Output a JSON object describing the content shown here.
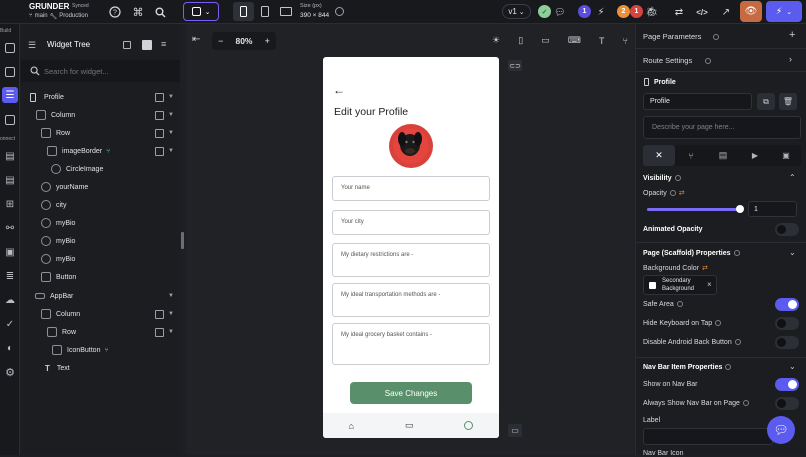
{
  "app": {
    "name": "GRUNDER",
    "sync_status": "Synced",
    "branch": "main",
    "environment": "Production"
  },
  "device": {
    "size_label": "Size (px)",
    "size_value": "390 × 844"
  },
  "version": {
    "label": "v1"
  },
  "badges": {
    "purple_count": "1",
    "orange_count": "2",
    "red_count": "1"
  },
  "colors": {
    "accent": "#5b5bf0",
    "brand_green": "#5a8f6b",
    "panel_bg": "#1b1d21",
    "warn_orange": "#e8913a",
    "error_red": "#d6453d"
  },
  "rail": {
    "build_label": "Build",
    "connect_label": "onnect"
  },
  "widget_tree": {
    "title": "Widget Tree",
    "search_placeholder": "Search for widget...",
    "items": [
      {
        "label": "Profile"
      },
      {
        "label": "Column"
      },
      {
        "label": "Row"
      },
      {
        "label": "imageBorder"
      },
      {
        "label": "CircleImage"
      },
      {
        "label": "yourName"
      },
      {
        "label": "city"
      },
      {
        "label": "myBio"
      },
      {
        "label": "myBio"
      },
      {
        "label": "myBio"
      },
      {
        "label": "Button"
      },
      {
        "label": "AppBar"
      },
      {
        "label": "Column"
      },
      {
        "label": "Row"
      },
      {
        "label": "IconButton"
      },
      {
        "label": "Text"
      }
    ]
  },
  "canvas": {
    "zoom": "80%"
  },
  "phone": {
    "title": "Edit your Profile",
    "fields": [
      {
        "placeholder": "Your name"
      },
      {
        "placeholder": "Your city"
      },
      {
        "placeholder": "My dietary restrictions are -"
      },
      {
        "placeholder": "My ideal transportation methods are -"
      },
      {
        "placeholder": "My ideal grocery basket contains -"
      }
    ],
    "save_button": "Save Changes"
  },
  "right_panel": {
    "page_parameters": "Page Parameters",
    "route_settings": "Route Settings",
    "page_label": "Profile",
    "page_name_value": "Profile",
    "description_placeholder": "Describe your page here...",
    "visibility": "Visibility",
    "opacity_label": "Opacity",
    "opacity_value": "1",
    "opacity_fraction": 1,
    "animated_opacity": "Animated Opacity",
    "scaffold_props": "Page (Scaffold) Properties",
    "background_color": "Background Color",
    "bg_chip_line1": "Secondary",
    "bg_chip_line2": "Background",
    "safe_area": "Safe Area",
    "hide_keyboard": "Hide Keyboard on Tap",
    "disable_back": "Disable Android Back Button",
    "nav_bar_props": "Nav Bar Item Properties",
    "show_on_nav": "Show on Nav Bar",
    "always_show_nav": "Always Show Nav Bar on Page",
    "label_caption": "Label",
    "nav_bar_icon": "Nav Bar Icon"
  }
}
